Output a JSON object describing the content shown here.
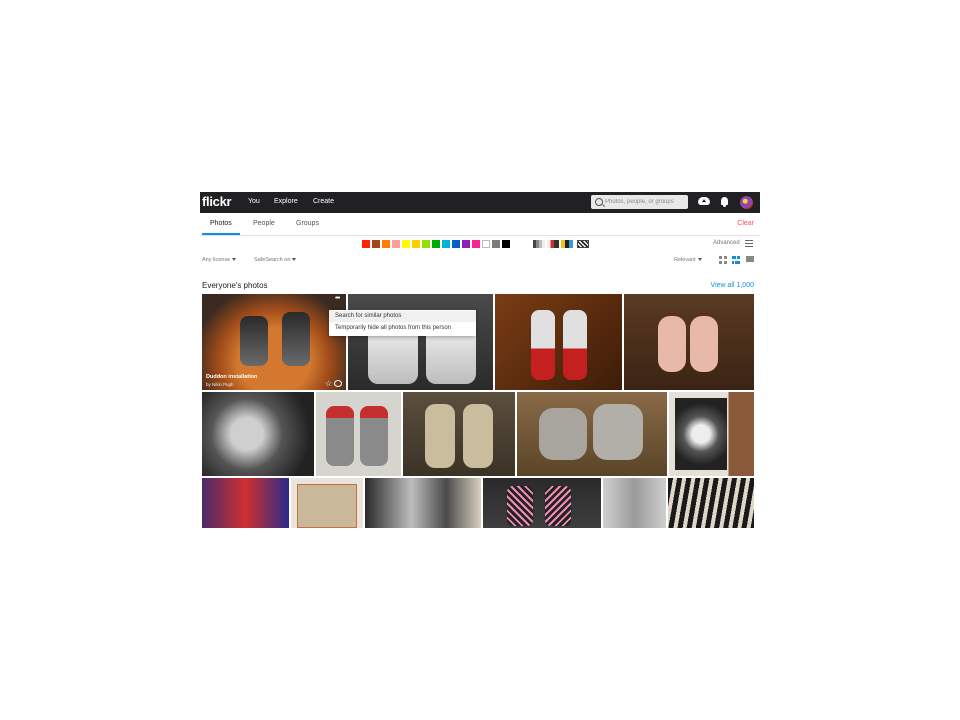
{
  "app": {
    "logo": "flickr",
    "nav": [
      "You",
      "Explore",
      "Create"
    ],
    "search_placeholder": "Photos, people, or groups"
  },
  "tabs": {
    "items": [
      "Photos",
      "People",
      "Groups"
    ],
    "active": "Photos",
    "clear": "Clear"
  },
  "colors": {
    "swatches": [
      "#ff2000",
      "#a24615",
      "#ff7c00",
      "#ff9f9c",
      "#fffa00",
      "#ffcf00",
      "#90e200",
      "#00ab00",
      "#00b2d4",
      "#0062c6",
      "#8c20ba",
      "#f52394",
      "#ffffff",
      "#7c7c7c",
      "#000000"
    ],
    "patterns": [
      "black-and-white",
      "shallow-depth-of-field",
      "minimalist",
      "patterns"
    ],
    "advanced": "Advanced"
  },
  "filters": {
    "license": "Any license",
    "safesearch": "SafeSearch on",
    "sort": "Relevant",
    "view_modes": [
      "grid",
      "justified",
      "single"
    ],
    "active_view": "justified"
  },
  "section": {
    "title": "Everyone's photos",
    "view_all": "View all 1,000"
  },
  "featured_photo": {
    "title": "Duddon installation",
    "author": "by Nikki Pugh"
  },
  "context_menu": {
    "items": [
      "Search for similar photos",
      "Temporarily hide all photos from this person"
    ]
  },
  "photos": [
    {
      "desc": "sneakers on orange crochet"
    },
    {
      "desc": "white sneakers"
    },
    {
      "desc": "red and white sneakers on wood floor"
    },
    {
      "desc": "pink ballet shoes"
    },
    {
      "desc": "black and white illustration"
    },
    {
      "desc": "grey red sneakers"
    },
    {
      "desc": "beige canvas sneakers"
    },
    {
      "desc": "worn grey sneakers"
    },
    {
      "desc": "sketch with pens"
    },
    {
      "desc": "colorful sneakers"
    },
    {
      "desc": "shoe box with sneakers"
    },
    {
      "desc": "pile of sneakers"
    },
    {
      "desc": "pink laced black sneakers"
    },
    {
      "desc": "white sneakers overhead"
    },
    {
      "desc": "zebra pattern"
    }
  ]
}
